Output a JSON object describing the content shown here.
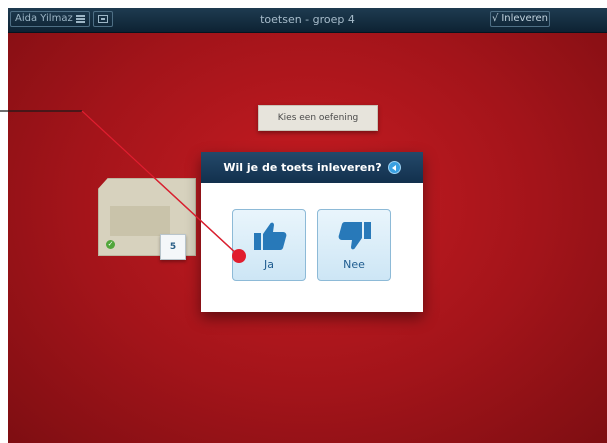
{
  "topbar": {
    "user_name": "Aida Yilmaz",
    "menu_icon": "menu-icon",
    "view_icon": "view-toggle-icon",
    "title": "toetsen - groep 4",
    "submit_check": "√",
    "submit_label": "Inleveren"
  },
  "main": {
    "exercise_label": "Kies een oefening",
    "folder": {
      "icon": "folder-icon",
      "completed_icon": "checkmark-icon",
      "count": "5"
    }
  },
  "dialog": {
    "title": "Wil je de toets inleveren?",
    "speaker_icon": "speaker-icon",
    "yes": {
      "label": "Ja",
      "icon": "thumbs-up-icon"
    },
    "no": {
      "label": "Nee",
      "icon": "thumbs-down-icon"
    }
  },
  "annotation": {
    "pointer_color": "#e11d2e"
  },
  "colors": {
    "background": "#b3161c",
    "topbar": "#12304d",
    "button_text": "#1e5c8f",
    "thumb": "#2879b9"
  }
}
